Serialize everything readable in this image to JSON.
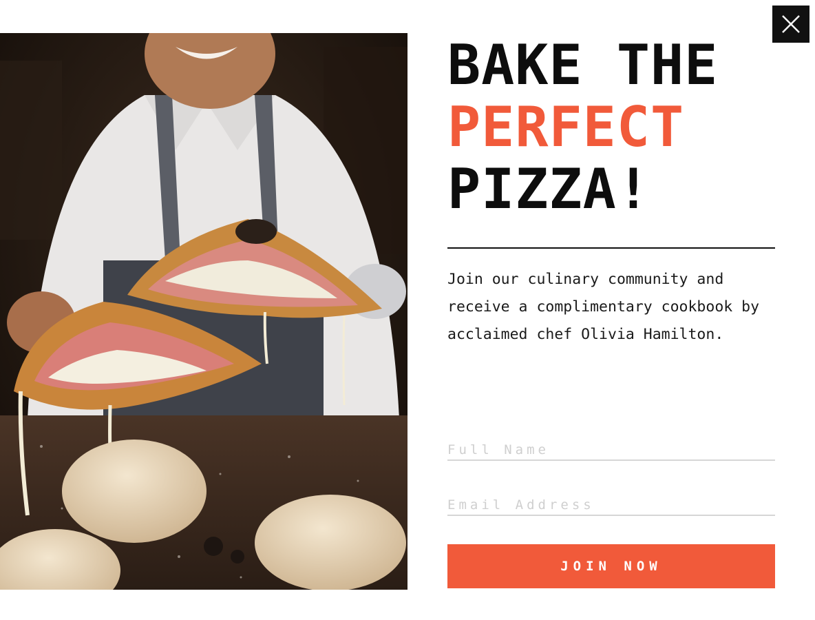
{
  "popup": {
    "close_icon": "close-icon",
    "hero_image": "chef-holding-pizza-photo",
    "headline": {
      "line1": "BAKE THE",
      "line2": "PERFECT",
      "line3": "PIZZA!"
    },
    "description": "Join our culinary community and receive a complimentary cookbook by acclaimed chef Olivia Hamilton.",
    "form": {
      "name_placeholder": "Full Name",
      "name_value": "",
      "email_placeholder": "Email Address",
      "email_value": "",
      "submit_label": "JOIN NOW"
    }
  },
  "colors": {
    "accent": "#f15a3a",
    "text": "#0d0d0d",
    "background": "#ffffff",
    "close_button": "#111111",
    "field_underline": "#d6d6d6"
  }
}
